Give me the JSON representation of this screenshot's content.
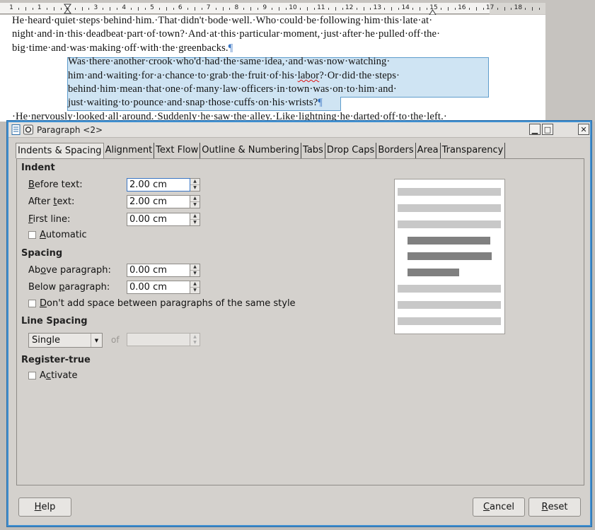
{
  "document": {
    "ruler_numbers": [
      "1",
      "1",
      "2",
      "3",
      "4",
      "5",
      "6",
      "7",
      "8",
      "9",
      "10",
      "11",
      "12",
      "13",
      "14",
      "15",
      "16",
      "17",
      "18"
    ],
    "lines": [
      "He·heard·quiet·steps·behind·him.·That·didn't·bode·well.·Who·could·be·following·him·this·late·at·",
      "night·and·in·this·deadbeat·part·of·town?·And·at·this·particular·moment,·just·after·he·pulled·off·the·",
      "big·time·and·was·making·off·with·the·greenbacks."
    ],
    "selected_lines": [
      "Was·there·another·crook·who'd·had·the·same·idea,·and·was·now·watching·",
      "him·and·waiting·for·a·chance·to·grab·the·fruit·of·his·",
      "labor",
      "?·Or·did·the·steps·",
      "behind·him·mean·that·one·of·many·law·officers·in·town·was·on·to·him·and·",
      "just·waiting·to·pounce·and·snap·those·cuffs·on·his·wrists?"
    ],
    "last_line": "·He·nervously·looked·all·around.·Suddenly·he·saw·the·alley.·Like·lightning·he·darted·off·to·the·left.·",
    "pilcrow": "¶"
  },
  "dialog": {
    "title": "Paragraph <2>",
    "tabs": [
      "Indents & Spacing",
      "Alignment",
      "Text Flow",
      "Outline & Numbering",
      "Tabs",
      "Drop Caps",
      "Borders",
      "Area",
      "Transparency"
    ],
    "indent": {
      "heading": "Indent",
      "before_label_u": "B",
      "before_label": "efore text:",
      "before_value": "2.00 cm",
      "after_label": "After ",
      "after_label_u": "t",
      "after_label_rest": "ext:",
      "after_value": "2.00 cm",
      "first_label_u": "F",
      "first_label": "irst line:",
      "first_value": "0.00 cm",
      "automatic_label_u": "A",
      "automatic_label": "utomatic"
    },
    "spacing": {
      "heading": "Spacing",
      "above_label": "Ab",
      "above_label_u": "o",
      "above_label_rest": "ve paragraph:",
      "above_value": "0.00 cm",
      "below_label": "Below ",
      "below_label_u": "p",
      "below_label_rest": "aragraph:",
      "below_value": "0.00 cm",
      "dont_add_u": "D",
      "dont_add_label": "on't add space between paragraphs of the same style"
    },
    "line_spacing": {
      "heading": "Line Spacing",
      "selected": "Single",
      "of_label": "of"
    },
    "register_true": {
      "heading": "Register-true",
      "activate_label": "A",
      "activate_label_u": "c",
      "activate_label_rest": "tivate"
    },
    "buttons": {
      "help_u": "H",
      "help": "elp",
      "cancel_u": "C",
      "cancel": "ancel",
      "reset_u": "R",
      "reset": "eset"
    }
  },
  "colors": {
    "dialog_border": "#3f8fd0",
    "selection_fill": "#cfe4f3",
    "preview_light": "#c8c8c8",
    "preview_dark": "#808080"
  }
}
